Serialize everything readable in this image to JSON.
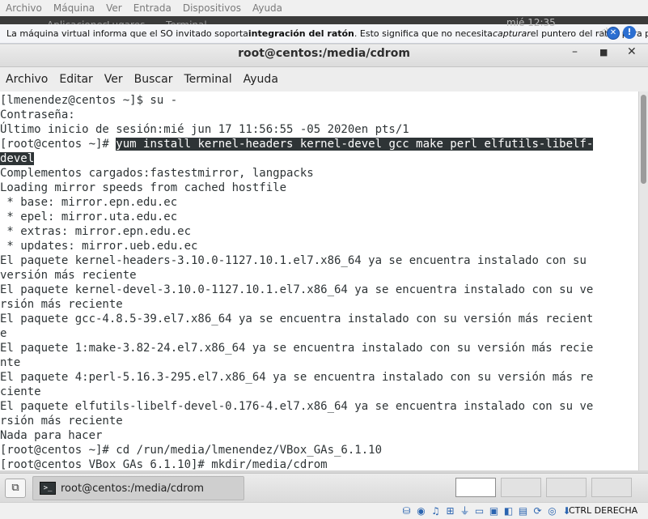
{
  "vbox_menu": [
    "Archivo",
    "Máquina",
    "Ver",
    "Entrada",
    "Dispositivos",
    "Ayuda"
  ],
  "gnome_bar": {
    "apps": "Aplicaciones",
    "places": "Lugares",
    "terminal": "Terminal",
    "clock": "mié 12:35"
  },
  "notice": {
    "pre": "La máquina virtual informa que el SO invitado soporta ",
    "bold": "integración del ratón",
    "mid": ". Esto significa que no necesita ",
    "italic": "capturar",
    "post": " el puntero del ratón para poder"
  },
  "window": {
    "title": "root@centos:/media/cdrom"
  },
  "terminal_menu": [
    "Archivo",
    "Editar",
    "Ver",
    "Buscar",
    "Terminal",
    "Ayuda"
  ],
  "terminal": {
    "prompt_line": "[root@centos ~]# ",
    "selected_1": "yum install kernel-headers kernel-devel gcc make perl elfutils-libelf-",
    "selected_2": "devel",
    "lines": [
      "[lmenendez@centos ~]$ su -",
      "Contraseña:",
      "Último inicio de sesión:mié jun 17 11:56:55 -05 2020en pts/1",
      "Complementos cargados:fastestmirror, langpacks",
      "Loading mirror speeds from cached hostfile",
      " * base: mirror.epn.edu.ec",
      " * epel: mirror.uta.edu.ec",
      " * extras: mirror.epn.edu.ec",
      " * updates: mirror.ueb.edu.ec",
      "El paquete kernel-headers-3.10.0-1127.10.1.el7.x86_64 ya se encuentra instalado con su",
      "versión más reciente",
      "El paquete kernel-devel-3.10.0-1127.10.1.el7.x86_64 ya se encuentra instalado con su ve",
      "rsión más reciente",
      "El paquete gcc-4.8.5-39.el7.x86_64 ya se encuentra instalado con su versión más recient",
      "e",
      "El paquete 1:make-3.82-24.el7.x86_64 ya se encuentra instalado con su versión más recie",
      "nte",
      "El paquete 4:perl-5.16.3-295.el7.x86_64 ya se encuentra instalado con su versión más re",
      "ciente",
      "El paquete elfutils-libelf-devel-0.176-4.el7.x86_64 ya se encuentra instalado con su ve",
      "rsión más reciente",
      "Nada para hacer",
      "[root@centos ~]# cd /run/media/lmenendez/VBox_GAs_6.1.10",
      "[root@centos VBox_GAs_6.1.10]# mkdir/media/cdrom"
    ]
  },
  "taskbar": {
    "task_label": "root@centos:/media/cdrom"
  },
  "statusbar": {
    "host_key": "CTRL DERECHA"
  },
  "colors": {
    "terminal_fg": "#2e3436",
    "selection_bg": "#2e3436",
    "notice_icon": "#2c6fd1"
  }
}
